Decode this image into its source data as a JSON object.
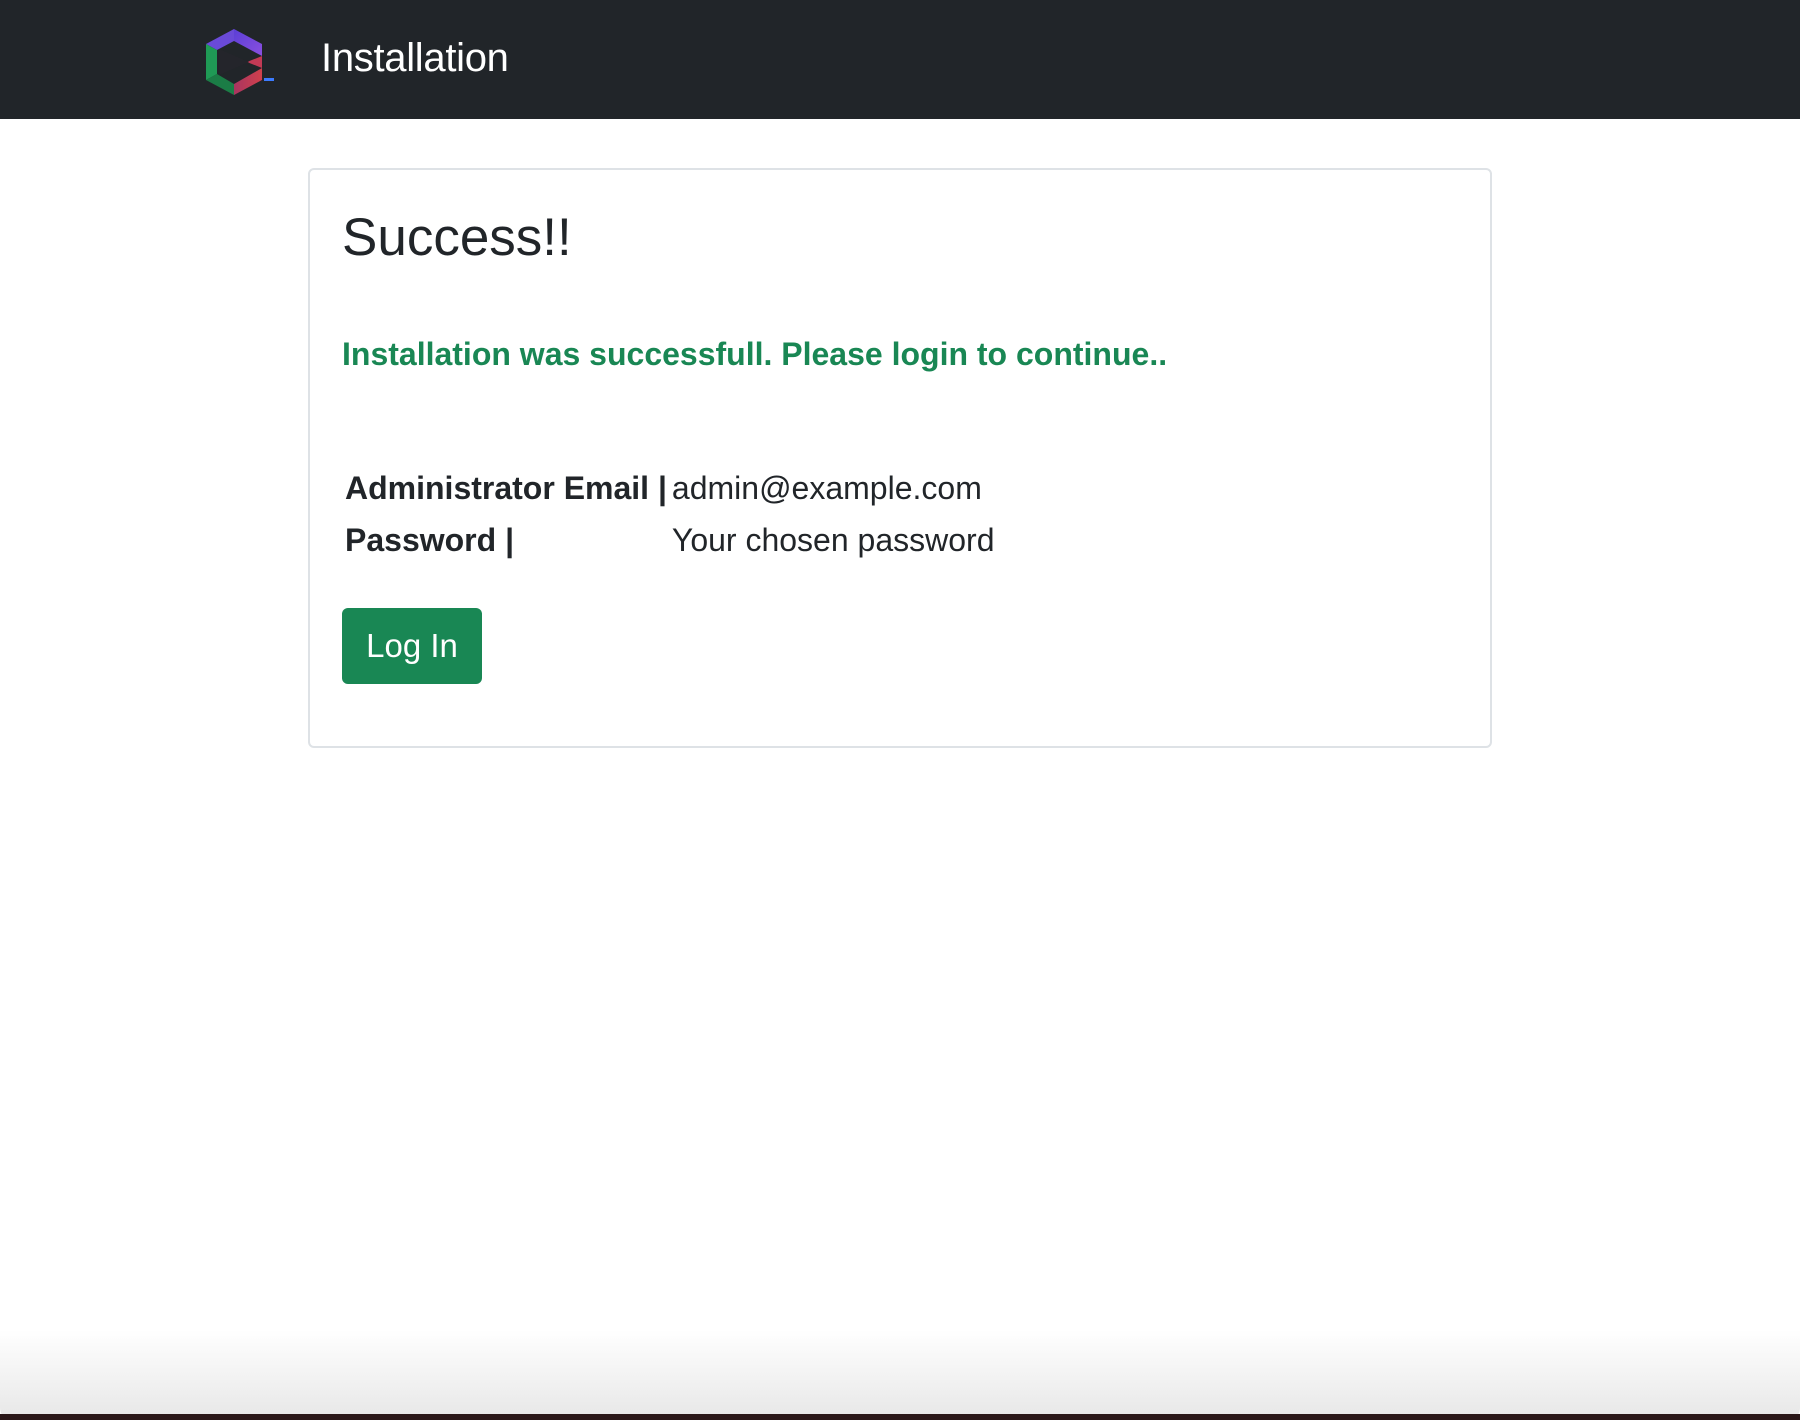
{
  "header": {
    "title": "Installation",
    "logo_icon": "hexagon-play-logo-icon",
    "background": "#212529"
  },
  "card": {
    "heading": "Success!!",
    "message": "Installation was successfull. Please login to continue..",
    "message_color": "#198754",
    "credentials": [
      {
        "label": "Administrator Email |",
        "value": "admin@example.com"
      },
      {
        "label": "Password |",
        "value": "Your chosen password"
      }
    ],
    "login_button_label": "Log In",
    "button_color": "#198754"
  }
}
